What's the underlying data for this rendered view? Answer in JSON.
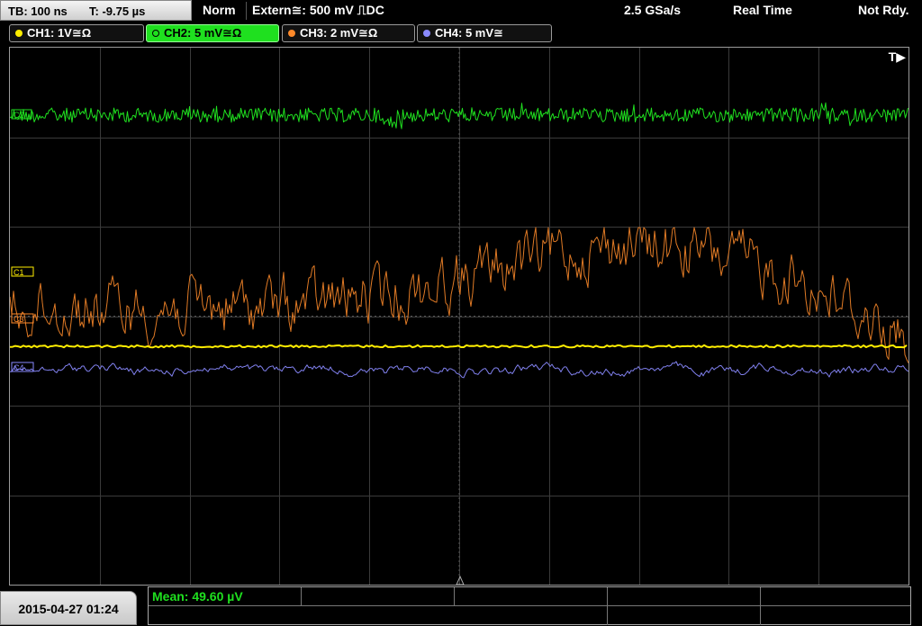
{
  "topbar": {
    "timebase": "TB: 100 ns",
    "trigger_time": "T: -9.75 µs",
    "mode": "Norm",
    "trigger_source": "Extern≅: 500 mV ⎍DC",
    "sample_rate": "2.5 GSa/s",
    "acq_mode": "Real Time",
    "status": "Not Rdy."
  },
  "channels": [
    {
      "label": "CH1: 1V≅Ω",
      "color": "#ffee00"
    },
    {
      "label": "CH2: 5 mV≅Ω",
      "color": "#1fe01f"
    },
    {
      "label": "CH3: 2 mV≅Ω",
      "color": "#ff8a2a"
    },
    {
      "label": "CH4: 5 mV≅",
      "color": "#8a8aff"
    }
  ],
  "plot": {
    "trigger_marker": "T▶",
    "ch2_marker": "C2",
    "ch1_marker": "C1",
    "ch3_marker": "C3",
    "ch4_marker": "C4"
  },
  "bottom": {
    "datetime": "2015-04-27 01:24",
    "mean": "Mean: 49.60 µV"
  }
}
